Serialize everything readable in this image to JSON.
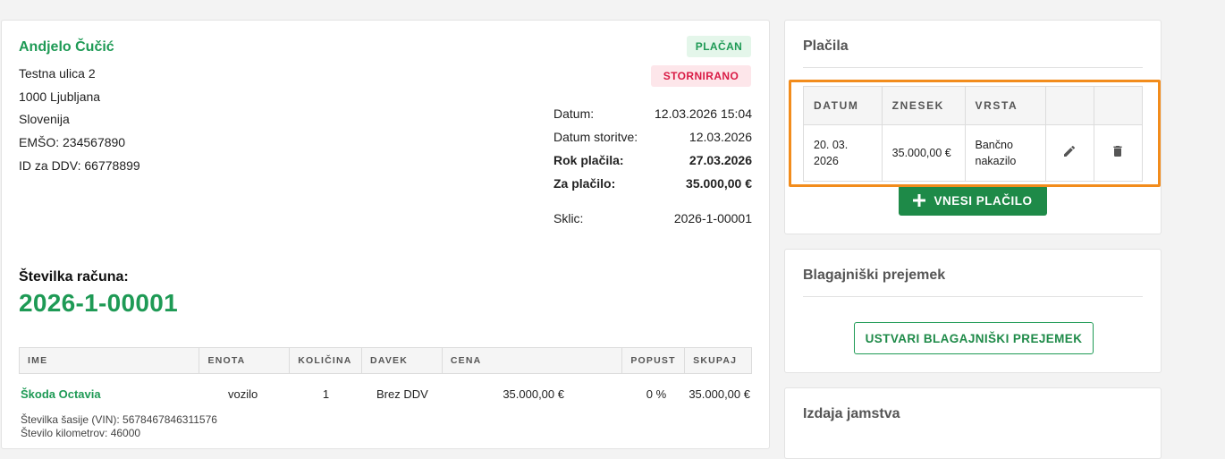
{
  "client": {
    "name": "Andjelo Čučić",
    "street": "Testna ulica 2",
    "city": "1000 Ljubljana",
    "country": "Slovenija",
    "emso": "EMŠO: 234567890",
    "vat": "ID za DDV: 66778899"
  },
  "badges": {
    "paid": "PLAČAN",
    "cancelled": "STORNIRANO"
  },
  "meta": {
    "date_label": "Datum:",
    "date_value": "12.03.2026 15:04",
    "service_label": "Datum storitve:",
    "service_value": "12.03.2026",
    "due_label": "Rok plačila:",
    "due_value": "27.03.2026",
    "topay_label": "Za plačilo:",
    "topay_value": "35.000,00 €",
    "ref_label": "Sklic:",
    "ref_value": "2026-1-00001"
  },
  "invoice": {
    "number_label": "Številka računa:",
    "number": "2026-1-00001"
  },
  "items": {
    "headers": [
      "IME",
      "ENOTA",
      "KOLIČINA",
      "DAVEK",
      "CENA",
      "POPUST",
      "SKUPAJ"
    ],
    "rows": [
      {
        "name": "Škoda Octavia",
        "unit": "vozilo",
        "qty": "1",
        "tax": "Brez DDV",
        "price": "35.000,00 €",
        "discount": "0 %",
        "total": "35.000,00 €",
        "vin": "Številka šasije (VIN): 5678467846311576",
        "km": "Število kilometrov: 46000"
      }
    ]
  },
  "payments": {
    "title": "Plačila",
    "headers": [
      "DATUM",
      "ZNESEK",
      "VRSTA"
    ],
    "rows": [
      {
        "date_line1": "20. 03.",
        "date_line2": "2026",
        "amount": "35.000,00 €",
        "type_line1": "Bančno",
        "type_line2": "nakazilo"
      }
    ],
    "add_button": "VNESI PLAČILO"
  },
  "receipt": {
    "title": "Blagajniški prejemek",
    "button": "USTVARI BLAGAJNIŠKI PREJEMEK"
  },
  "warranty": {
    "title": "Izdaja jamstva"
  },
  "colors": {
    "accent": "#1e9a55",
    "button": "#1e8a48",
    "highlight": "#f28c1c",
    "storno": "#d91b45"
  }
}
